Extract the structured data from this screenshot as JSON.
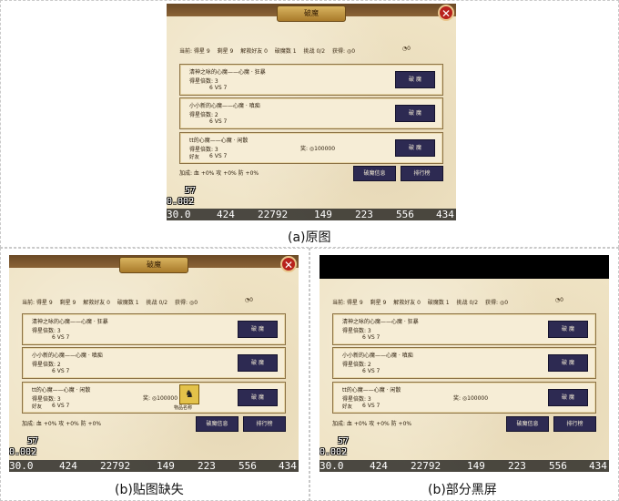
{
  "panels": [
    {
      "title": "破魔",
      "close": "✕",
      "info": {
        "current": "当前: 得星 9",
        "remain": "剩星 9",
        "unlock": "解救好友 0",
        "breaks": "破魔数 1",
        "challenge": "挑战 0/2",
        "gain": "获得: ◎0",
        "coin": "0"
      },
      "cards": [
        {
          "name": "清神之咏的心魔——心魔 · 狂暴",
          "mult": "得星倍数: 3",
          "vs": "6 VS 7",
          "button": "破 魔"
        },
        {
          "name": "小小新的心魔——心魔 · 嗔痴",
          "mult": "得星倍数: 2",
          "vs": "6 VS 7",
          "button": "破 魔"
        },
        {
          "name": "tt的心魔——心魔 · 闲散",
          "mult": "得星倍数: 3",
          "friend": "好友",
          "vs": "6 VS 7",
          "reward": "奖: ◎100000",
          "button": "破 魔"
        }
      ],
      "bonus": "加成: 血 +0%  攻 +0%  防 +0%",
      "info_button": "破魔信息",
      "rank_button": "排行榜",
      "fps1": "57",
      "fps2": "0.002",
      "perf": [
        "30.0",
        "424",
        "22792",
        "149",
        "223",
        "556",
        "434"
      ],
      "caption": "(a)原图"
    },
    {
      "title": "破魔",
      "close": "✕",
      "info": {
        "current": "当前: 得星 9",
        "remain": "剩星 9",
        "unlock": "解救好友 0",
        "breaks": "破魔数 1",
        "challenge": "挑战 0/2",
        "gain": "获得: ◎0",
        "coin": "0"
      },
      "cards": [
        {
          "name": "清神之咏的心魔——心魔 · 狂暴",
          "mult": "得星倍数: 3",
          "vs": "6 VS 7",
          "button": "破 魔"
        },
        {
          "name": "小小新的心魔——心魔 · 嗔痴",
          "mult": "得星倍数: 2",
          "vs": "6 VS 7",
          "button": "破 魔"
        },
        {
          "name": "tt的心魔——心魔 · 闲散",
          "mult": "得星倍数: 3",
          "friend": "好友",
          "vs": "6 VS 7",
          "reward": "奖: ◎100000",
          "item_label": "物品名称",
          "button": "破 魔"
        }
      ],
      "bonus": "加成: 血 +0%  攻 +0%  防 +0%",
      "info_button": "破魔信息",
      "rank_button": "排行榜",
      "fps1": "57",
      "fps2": "0.002",
      "perf": [
        "30.0",
        "424",
        "22792",
        "149",
        "223",
        "556",
        "434"
      ],
      "caption": "(b)贴图缺失"
    },
    {
      "info": {
        "current": "当前: 得星 9",
        "remain": "剩星 9",
        "unlock": "解救好友 0",
        "breaks": "破魔数 1",
        "challenge": "挑战 0/2",
        "gain": "获得: ◎0",
        "coin": "0"
      },
      "cards": [
        {
          "name": "清神之咏的心魔——心魔 · 狂暴",
          "mult": "得星倍数: 3",
          "vs": "6 VS 7",
          "button": "破 魔"
        },
        {
          "name": "小小新的心魔——心魔 · 嗔痴",
          "mult": "得星倍数: 2",
          "vs": "6 VS 7",
          "button": "破 魔"
        },
        {
          "name": "tt的心魔——心魔 · 闲散",
          "mult": "得星倍数: 3",
          "friend": "好友",
          "vs": "6 VS 7",
          "reward": "奖: ◎100000",
          "button": "破 魔"
        }
      ],
      "bonus": "加成: 血 +0%  攻 +0%  防 +0%",
      "info_button": "破魔信息",
      "rank_button": "排行榜",
      "fps1": "57",
      "fps2": "0.002",
      "perf": [
        "30.0",
        "424",
        "22792",
        "149",
        "223",
        "556",
        "434"
      ],
      "caption": "(b)部分黑屏"
    }
  ]
}
